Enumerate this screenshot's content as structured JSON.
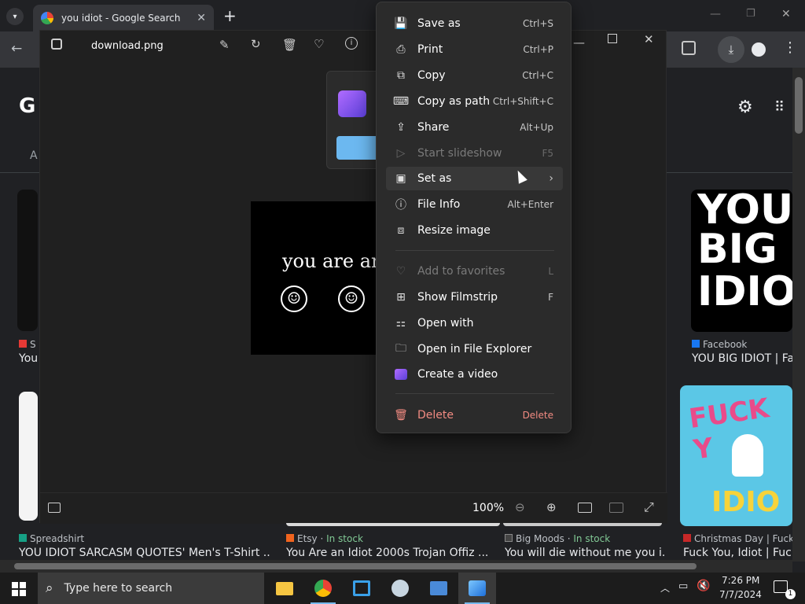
{
  "browser": {
    "tab_title": "you idiot - Google Search",
    "new_tab": "+",
    "google_logo": "G",
    "nav_letter": "A"
  },
  "results": [
    {
      "source": "S",
      "title": "You"
    },
    {
      "source": "Facebook",
      "title": "YOU BIG IDIOT | Fac"
    },
    {
      "source": "Spreadshirt",
      "title": "YOU IDIOT SARCASM QUOTES' Men's T-Shirt ..."
    },
    {
      "source": "Etsy",
      "stock": "In stock",
      "title": "You Are an Idiot 2000s Trojan Offiz ..."
    },
    {
      "source": "Big Moods",
      "stock": "In stock",
      "title": "You will die without me you i..."
    },
    {
      "source": "Christmas Day | Fuck Y",
      "title": "Fuck You, Idiot | Fuck"
    }
  ],
  "thumb_text": {
    "you": "YOU",
    "big": "BIG",
    "idio": "IDIO",
    "fuck": "FUCK Y",
    "idiot2": "IDIO"
  },
  "viewer": {
    "filename": "download.png",
    "image_text": "you are an",
    "zoom": "100%"
  },
  "menu": {
    "items": [
      {
        "label": "Save as",
        "shortcut": "Ctrl+S",
        "icon": "save-as-icon"
      },
      {
        "label": "Print",
        "shortcut": "Ctrl+P",
        "icon": "print-icon"
      },
      {
        "label": "Copy",
        "shortcut": "Ctrl+C",
        "icon": "copy-icon"
      },
      {
        "label": "Copy as path",
        "shortcut": "Ctrl+Shift+C",
        "icon": "copy-path-icon"
      },
      {
        "label": "Share",
        "shortcut": "Alt+Up",
        "icon": "share-icon"
      },
      {
        "label": "Start slideshow",
        "shortcut": "F5",
        "icon": "slideshow-icon"
      },
      {
        "label": "Set as",
        "shortcut": "",
        "icon": "set-as-icon"
      },
      {
        "label": "File Info",
        "shortcut": "Alt+Enter",
        "icon": "info-icon"
      },
      {
        "label": "Resize image",
        "shortcut": "",
        "icon": "resize-icon"
      },
      {
        "label": "Add to favorites",
        "shortcut": "L",
        "icon": "heart-icon"
      },
      {
        "label": "Show Filmstrip",
        "shortcut": "F",
        "icon": "filmstrip-icon"
      },
      {
        "label": "Open with",
        "shortcut": "",
        "icon": "open-with-icon"
      },
      {
        "label": "Open in File Explorer",
        "shortcut": "",
        "icon": "folder-icon"
      },
      {
        "label": "Create a video",
        "shortcut": "",
        "icon": "clipchamp-icon"
      },
      {
        "label": "Delete",
        "shortcut": "Delete",
        "icon": "trash-icon"
      }
    ]
  },
  "taskbar": {
    "search_placeholder": "Type here to search",
    "time": "7:26 PM",
    "date": "7/7/2024",
    "notifications": "1"
  }
}
